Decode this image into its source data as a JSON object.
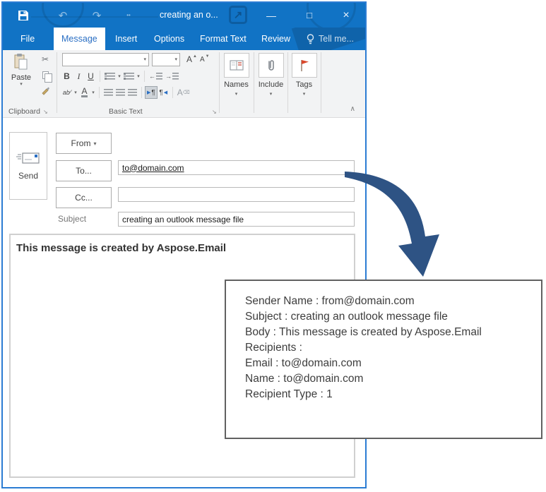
{
  "window": {
    "title": "creating an o..."
  },
  "icons": {
    "undo": "↶",
    "redo": "↷",
    "qat_more": "••",
    "minimize": "—",
    "maximize": "□",
    "close": "×",
    "dropdown": "▾",
    "cut": "✂",
    "launcher": "↘",
    "collapse": "∧",
    "bold": "B",
    "italic": "I",
    "underline": "U",
    "grow_font": "A",
    "shrink_font": "A",
    "caret_up": "▲",
    "caret_down": "▼",
    "highlight": "ab",
    "font_color": "A",
    "clear_format": "A",
    "pilcrow": "¶",
    "tri_right": "▶",
    "tri_left": "◀",
    "indent_left": "←",
    "indent_right": "→"
  },
  "tabs": [
    {
      "label": "File"
    },
    {
      "label": "Message"
    },
    {
      "label": "Insert"
    },
    {
      "label": "Options"
    },
    {
      "label": "Format Text"
    },
    {
      "label": "Review"
    },
    {
      "label": "Tell me..."
    }
  ],
  "ribbon": {
    "paste_label": "Paste",
    "clipboard_label": "Clipboard",
    "basic_text_label": "Basic Text",
    "names_label": "Names",
    "include_label": "Include",
    "tags_label": "Tags"
  },
  "compose": {
    "send_label": "Send",
    "from_label": "From",
    "to_label": "To...",
    "cc_label": "Cc...",
    "subject_label": "Subject",
    "to_value": "to@domain.com",
    "cc_value": "",
    "subject_value": "creating an outlook message file",
    "body_text": "This message is created by Aspose.Email"
  },
  "callout": {
    "lines": [
      "Sender Name : from@domain.com",
      "Subject : creating an outlook message file",
      "Body : This message is created by Aspose.Email",
      "Recipients :",
      "",
      "Email : to@domain.com",
      "Name : to@domain.com",
      "Recipient Type : 1"
    ]
  },
  "colors": {
    "titlebar": "#1173c5",
    "window_border": "#2b7cd3",
    "active_tab_text": "#2a6fc4",
    "arrow": "#2e5384",
    "flag_red": "#d9472b"
  }
}
